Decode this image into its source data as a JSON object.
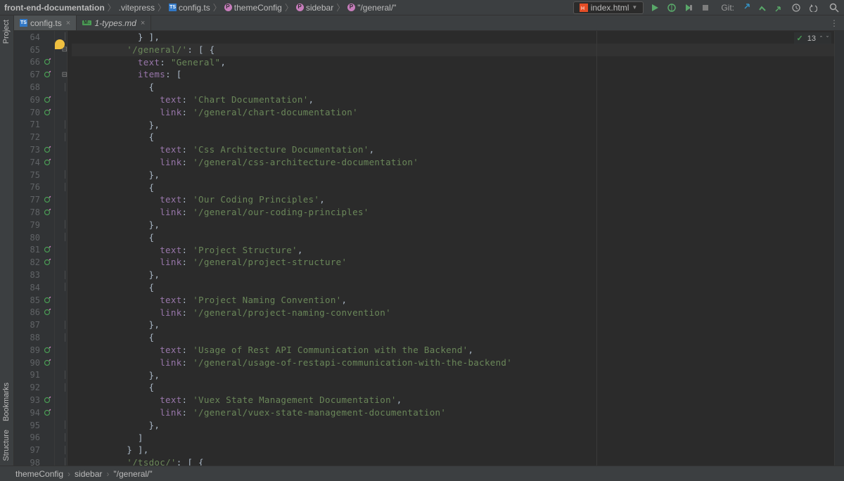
{
  "breadcrumbs": {
    "root": "front-end-documentation",
    "vitepress": ".vitepress",
    "config": "config.ts",
    "themeConfig": "themeConfig",
    "sidebar": "sidebar",
    "general": "\"/general/\""
  },
  "runConfig": {
    "name": "index.html"
  },
  "git": {
    "label": "Git:"
  },
  "tabs": {
    "config": "config.ts",
    "types": "1-types.md"
  },
  "problems": {
    "count": "13"
  },
  "leftbar": {
    "project": "Project",
    "bookmarks": "Bookmarks",
    "structure": "Structure"
  },
  "statusbar": {
    "themeConfig": "themeConfig",
    "sidebar": "sidebar",
    "general": "\"/general/\""
  },
  "code": {
    "startLine": 64,
    "lines": [
      "            } ],",
      "          '/general/': [ {",
      "            text: \"General\",",
      "            items: [",
      "              {",
      "                text: 'Chart Documentation',",
      "                link: '/general/chart-documentation'",
      "              },",
      "              {",
      "                text: 'Css Architecture Documentation',",
      "                link: '/general/css-architecture-documentation'",
      "              },",
      "              {",
      "                text: 'Our Coding Principles',",
      "                link: '/general/our-coding-principles'",
      "              },",
      "              {",
      "                text: 'Project Structure',",
      "                link: '/general/project-structure'",
      "              },",
      "              {",
      "                text: 'Project Naming Convention',",
      "                link: '/general/project-naming-convention'",
      "              },",
      "              {",
      "                text: 'Usage of Rest API Communication with the Backend',",
      "                link: '/general/usage-of-restapi-communication-with-the-backend'",
      "              },",
      "              {",
      "                text: 'Vuex State Management Documentation',",
      "                link: '/general/vuex-state-management-documentation'",
      "              },",
      "            ]",
      "          } ],",
      "          '/tsdoc/': [ {"
    ]
  }
}
